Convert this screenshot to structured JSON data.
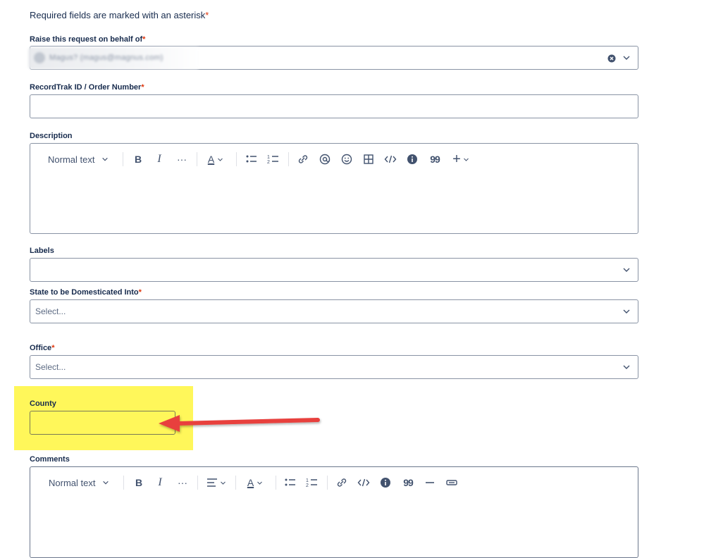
{
  "intro": {
    "text": "Required fields are marked with an asterisk",
    "asterisk": "*"
  },
  "fields": {
    "behalf": {
      "label": "Raise this request on behalf of",
      "asterisk": "*",
      "value_blurred": "Magus? (magus@magnus.com)"
    },
    "recordtrak": {
      "label": "RecordTrak ID / Order Number",
      "asterisk": "*",
      "value": ""
    },
    "description": {
      "label": "Description"
    },
    "labels": {
      "label": "Labels"
    },
    "state": {
      "label": "State to be Domesticated Into",
      "asterisk": "*",
      "placeholder": "Select..."
    },
    "office": {
      "label": "Office",
      "asterisk": "*",
      "placeholder": "Select..."
    },
    "county": {
      "label": "County",
      "value": ""
    },
    "comments": {
      "label": "Comments"
    }
  },
  "toolbar": {
    "text_style": "Normal text",
    "bold": "B",
    "italic": "I",
    "more": "···",
    "font_color": "A",
    "quote": "99",
    "plus": "+"
  },
  "colors": {
    "highlight": "#fff75a",
    "arrow": "#e8403e",
    "required": "#de350b",
    "border": "#8993a4"
  },
  "icons": [
    "clear-icon",
    "chevron-down-icon",
    "bullet-list-icon",
    "numbered-list-icon",
    "link-icon",
    "mention-icon",
    "emoji-icon",
    "table-icon",
    "code-icon",
    "info-icon",
    "quote-icon",
    "plus-icon",
    "align-icon",
    "divider-icon",
    "expand-icon"
  ]
}
